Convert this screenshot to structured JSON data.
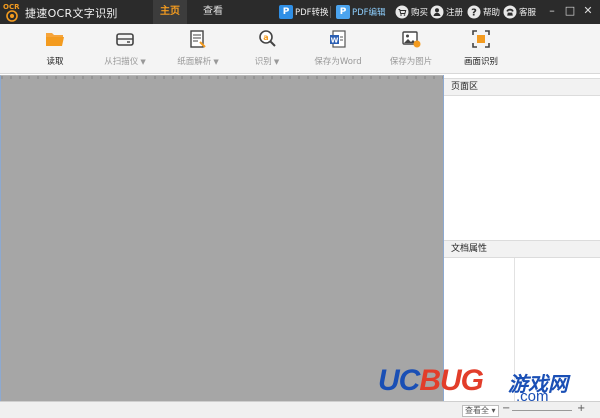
{
  "app": {
    "logo_text": "OCR",
    "title": "捷速OCR文字识别"
  },
  "main_tabs": [
    {
      "label": "主页",
      "active": true
    },
    {
      "label": "查看",
      "active": false
    }
  ],
  "title_links": {
    "pdf_convert": "PDF转换",
    "pdf_edit": "PDF编辑",
    "buy": "购买",
    "register": "注册",
    "help": "帮助",
    "service": "客服",
    "pdf_badge": "P"
  },
  "window_controls": {
    "minimize": "–",
    "maximize": "□",
    "close": "✕"
  },
  "toolbar": {
    "read": "读取",
    "scan": "从扫描仪",
    "paper": "纸面解析",
    "recognize": "识别",
    "save_word": "保存为Word",
    "save_image": "保存为图片",
    "screen_ocr": "画面识别",
    "caret": "▼"
  },
  "panels": {
    "page_area": "页面区",
    "doc_props": "文档属性"
  },
  "statusbar": {
    "zoom_select": "查看全 ▾",
    "minus": "−",
    "plus": "+"
  },
  "watermark": {
    "uc": "UC",
    "bug": "BUG",
    "cn": "游戏网",
    "com": ".com"
  },
  "colors": {
    "titlebar": "#2b2b2b",
    "active_tab": "#f39b1f",
    "pdf_blue": "#2f8fe6",
    "workspace": "#a6a6a6",
    "accent_border": "#8da9d0"
  }
}
